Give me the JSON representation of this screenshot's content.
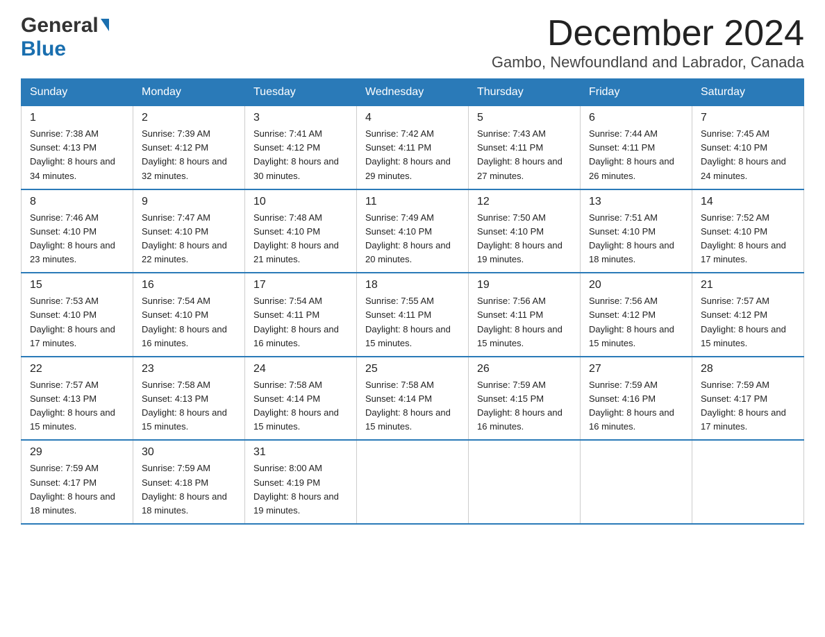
{
  "header": {
    "logo_general": "General",
    "logo_blue": "Blue",
    "month_title": "December 2024",
    "location": "Gambo, Newfoundland and Labrador, Canada"
  },
  "weekdays": [
    "Sunday",
    "Monday",
    "Tuesday",
    "Wednesday",
    "Thursday",
    "Friday",
    "Saturday"
  ],
  "weeks": [
    [
      {
        "day": "1",
        "sunrise": "Sunrise: 7:38 AM",
        "sunset": "Sunset: 4:13 PM",
        "daylight": "Daylight: 8 hours and 34 minutes."
      },
      {
        "day": "2",
        "sunrise": "Sunrise: 7:39 AM",
        "sunset": "Sunset: 4:12 PM",
        "daylight": "Daylight: 8 hours and 32 minutes."
      },
      {
        "day": "3",
        "sunrise": "Sunrise: 7:41 AM",
        "sunset": "Sunset: 4:12 PM",
        "daylight": "Daylight: 8 hours and 30 minutes."
      },
      {
        "day": "4",
        "sunrise": "Sunrise: 7:42 AM",
        "sunset": "Sunset: 4:11 PM",
        "daylight": "Daylight: 8 hours and 29 minutes."
      },
      {
        "day": "5",
        "sunrise": "Sunrise: 7:43 AM",
        "sunset": "Sunset: 4:11 PM",
        "daylight": "Daylight: 8 hours and 27 minutes."
      },
      {
        "day": "6",
        "sunrise": "Sunrise: 7:44 AM",
        "sunset": "Sunset: 4:11 PM",
        "daylight": "Daylight: 8 hours and 26 minutes."
      },
      {
        "day": "7",
        "sunrise": "Sunrise: 7:45 AM",
        "sunset": "Sunset: 4:10 PM",
        "daylight": "Daylight: 8 hours and 24 minutes."
      }
    ],
    [
      {
        "day": "8",
        "sunrise": "Sunrise: 7:46 AM",
        "sunset": "Sunset: 4:10 PM",
        "daylight": "Daylight: 8 hours and 23 minutes."
      },
      {
        "day": "9",
        "sunrise": "Sunrise: 7:47 AM",
        "sunset": "Sunset: 4:10 PM",
        "daylight": "Daylight: 8 hours and 22 minutes."
      },
      {
        "day": "10",
        "sunrise": "Sunrise: 7:48 AM",
        "sunset": "Sunset: 4:10 PM",
        "daylight": "Daylight: 8 hours and 21 minutes."
      },
      {
        "day": "11",
        "sunrise": "Sunrise: 7:49 AM",
        "sunset": "Sunset: 4:10 PM",
        "daylight": "Daylight: 8 hours and 20 minutes."
      },
      {
        "day": "12",
        "sunrise": "Sunrise: 7:50 AM",
        "sunset": "Sunset: 4:10 PM",
        "daylight": "Daylight: 8 hours and 19 minutes."
      },
      {
        "day": "13",
        "sunrise": "Sunrise: 7:51 AM",
        "sunset": "Sunset: 4:10 PM",
        "daylight": "Daylight: 8 hours and 18 minutes."
      },
      {
        "day": "14",
        "sunrise": "Sunrise: 7:52 AM",
        "sunset": "Sunset: 4:10 PM",
        "daylight": "Daylight: 8 hours and 17 minutes."
      }
    ],
    [
      {
        "day": "15",
        "sunrise": "Sunrise: 7:53 AM",
        "sunset": "Sunset: 4:10 PM",
        "daylight": "Daylight: 8 hours and 17 minutes."
      },
      {
        "day": "16",
        "sunrise": "Sunrise: 7:54 AM",
        "sunset": "Sunset: 4:10 PM",
        "daylight": "Daylight: 8 hours and 16 minutes."
      },
      {
        "day": "17",
        "sunrise": "Sunrise: 7:54 AM",
        "sunset": "Sunset: 4:11 PM",
        "daylight": "Daylight: 8 hours and 16 minutes."
      },
      {
        "day": "18",
        "sunrise": "Sunrise: 7:55 AM",
        "sunset": "Sunset: 4:11 PM",
        "daylight": "Daylight: 8 hours and 15 minutes."
      },
      {
        "day": "19",
        "sunrise": "Sunrise: 7:56 AM",
        "sunset": "Sunset: 4:11 PM",
        "daylight": "Daylight: 8 hours and 15 minutes."
      },
      {
        "day": "20",
        "sunrise": "Sunrise: 7:56 AM",
        "sunset": "Sunset: 4:12 PM",
        "daylight": "Daylight: 8 hours and 15 minutes."
      },
      {
        "day": "21",
        "sunrise": "Sunrise: 7:57 AM",
        "sunset": "Sunset: 4:12 PM",
        "daylight": "Daylight: 8 hours and 15 minutes."
      }
    ],
    [
      {
        "day": "22",
        "sunrise": "Sunrise: 7:57 AM",
        "sunset": "Sunset: 4:13 PM",
        "daylight": "Daylight: 8 hours and 15 minutes."
      },
      {
        "day": "23",
        "sunrise": "Sunrise: 7:58 AM",
        "sunset": "Sunset: 4:13 PM",
        "daylight": "Daylight: 8 hours and 15 minutes."
      },
      {
        "day": "24",
        "sunrise": "Sunrise: 7:58 AM",
        "sunset": "Sunset: 4:14 PM",
        "daylight": "Daylight: 8 hours and 15 minutes."
      },
      {
        "day": "25",
        "sunrise": "Sunrise: 7:58 AM",
        "sunset": "Sunset: 4:14 PM",
        "daylight": "Daylight: 8 hours and 15 minutes."
      },
      {
        "day": "26",
        "sunrise": "Sunrise: 7:59 AM",
        "sunset": "Sunset: 4:15 PM",
        "daylight": "Daylight: 8 hours and 16 minutes."
      },
      {
        "day": "27",
        "sunrise": "Sunrise: 7:59 AM",
        "sunset": "Sunset: 4:16 PM",
        "daylight": "Daylight: 8 hours and 16 minutes."
      },
      {
        "day": "28",
        "sunrise": "Sunrise: 7:59 AM",
        "sunset": "Sunset: 4:17 PM",
        "daylight": "Daylight: 8 hours and 17 minutes."
      }
    ],
    [
      {
        "day": "29",
        "sunrise": "Sunrise: 7:59 AM",
        "sunset": "Sunset: 4:17 PM",
        "daylight": "Daylight: 8 hours and 18 minutes."
      },
      {
        "day": "30",
        "sunrise": "Sunrise: 7:59 AM",
        "sunset": "Sunset: 4:18 PM",
        "daylight": "Daylight: 8 hours and 18 minutes."
      },
      {
        "day": "31",
        "sunrise": "Sunrise: 8:00 AM",
        "sunset": "Sunset: 4:19 PM",
        "daylight": "Daylight: 8 hours and 19 minutes."
      },
      null,
      null,
      null,
      null
    ]
  ]
}
